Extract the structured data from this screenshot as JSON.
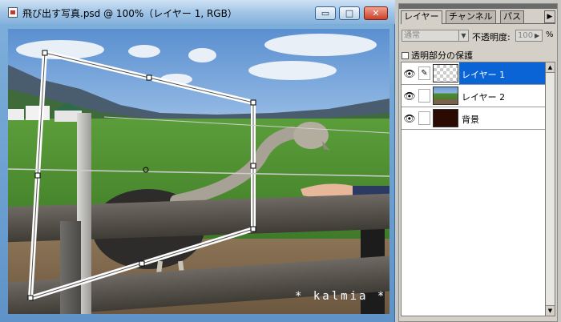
{
  "window": {
    "title": "飛び出す写真.psd @ 100%（レイヤー 1, RGB）",
    "min_glyph": "▭",
    "max_glyph": "□",
    "close_glyph": "✕",
    "icon": "psd-document-icon"
  },
  "canvas": {
    "watermark": "* kalmia *"
  },
  "palette": {
    "tabs": [
      "レイヤー",
      "チャンネル",
      "パス"
    ],
    "active_tab": "レイヤー",
    "menu_arrow": "▶",
    "blend_mode": "通常",
    "opacity_label": "不透明度:",
    "opacity_value": "100",
    "opacity_unit": "%",
    "lock_label": "透明部分の保護",
    "layers": [
      {
        "name": "レイヤー 1",
        "visible": true,
        "selected": true,
        "thumb": "transparent",
        "link": "brush-icon"
      },
      {
        "name": "レイヤー 2",
        "visible": true,
        "selected": false,
        "thumb": "photo"
      },
      {
        "name": "背景",
        "visible": true,
        "selected": false,
        "thumb": "dark"
      }
    ]
  },
  "colors": {
    "selection": "#0a64d6",
    "titlebar": "#9ec3e6",
    "close_button": "#c8412a"
  }
}
